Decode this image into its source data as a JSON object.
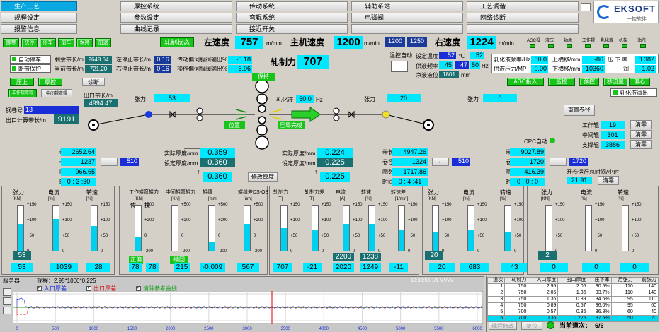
{
  "menu": [
    {
      "label": "生产工艺",
      "arrow": "⇩",
      "active": true
    },
    {
      "label": "规程设定",
      "arrow": ""
    },
    {
      "label": "报警信息",
      "arrow": ""
    },
    {
      "label": "厚控系统",
      "arrow": "⇩"
    },
    {
      "label": "参数设定",
      "arrow": ""
    },
    {
      "label": "曲线记录",
      "arrow": ""
    },
    {
      "label": "传动系统",
      "arrow": "⇩"
    },
    {
      "label": "弯辊系统",
      "arrow": "⇩"
    },
    {
      "label": "接近开关",
      "arrow": ""
    },
    {
      "label": "辅助系站",
      "arrow": "⇩"
    },
    {
      "label": "电磁阀",
      "arrow": "⇩"
    },
    {
      "label": "",
      "arrow": ""
    },
    {
      "label": "工艺调谐",
      "arrow": ""
    },
    {
      "label": "网络诊断",
      "arrow": ""
    },
    {
      "label": "",
      "arrow": ""
    }
  ],
  "brand": {
    "name": "EKSOFT",
    "sub": "一控软件"
  },
  "toolbar": {
    "buttons": [
      "御带",
      "快停",
      "停车",
      "前车",
      "保持",
      "加速"
    ],
    "state": "轧制状态"
  },
  "speed": {
    "left_label": "左速度",
    "left": "757",
    "mid_label": "主机速度",
    "mid": "1200",
    "mid_set": "1200",
    "mid_set2": "1250",
    "right_label": "右速度",
    "right": "1224",
    "unit": "m/min"
  },
  "agc": {
    "labels": [
      "AGC投",
      "液压",
      "轴承",
      "工作辊",
      "乳化液",
      "机架",
      "油汽"
    ]
  },
  "left_ctrl": {
    "auto_stop": "自动停车",
    "broken": "断带保护",
    "remain_label": "剩余带长/m",
    "remain": "2648.64",
    "first_label": "当前带长/m",
    "first": "721.20",
    "lstop_label": "左停止带长/m",
    "lstop": "0.16",
    "rstop_label": "右停止带长/m",
    "rstop": "0.16",
    "drive_label": "传动偏伺服阀输出%",
    "drive": "-5.18",
    "op_label": "操作偏伺服阀输出%",
    "op": "-6.96"
  },
  "force": {
    "label": "轧制力",
    "value": "707"
  },
  "temp": {
    "auto": "温控自动",
    "set_label": "设定温度",
    "set": "52",
    "unit": "℃",
    "set2": "52",
    "flow_label": "供液频率",
    "f1": "45",
    "f2": "47",
    "f3": "50",
    "hz": "Hz",
    "net_label": "净液液位",
    "net": "1801",
    "mm": "mm"
  },
  "emul": {
    "freq_label": "乳化液频率/Hz",
    "freq": "50.0",
    "press_label": "供液压力/MP",
    "press": "0.00",
    "up_label": "上横移/mm",
    "up": "-86",
    "down_label": "下横移/mm",
    "down": "-10360",
    "pxd_label": "压 下 率",
    "pxd": "0.382",
    "rl_label": "润",
    "rl": "1.02"
  },
  "agc_btns": [
    "AGC投入",
    "监控",
    "预控",
    "秒流量",
    "偏心"
  ],
  "overflow": "乳化液溢出",
  "mode": {
    "a": "压上",
    "b": "厚控",
    "c": "诊断",
    "d": "工作辊弯辊",
    "e": "中间辊弯辊"
  },
  "coil": {
    "steel_label": "钢卷号",
    "steel": "13",
    "out_label": "出口计算带长/m",
    "out": "9191",
    "exit_label": "出口带长/m",
    "exit": "4994.47"
  },
  "mill": {
    "tension_l_label": "张力",
    "tension_l": "53",
    "tension_r_label": "张力",
    "tension_r": "20",
    "tension_rr_label": "张力",
    "tension_rr": "0",
    "emul_label": "乳化液",
    "emul": "50.0",
    "emul_unit": "Hz",
    "hold": "保持",
    "pos": "位置",
    "press": "压靠完成",
    "reset": "重置卷径",
    "cpc": "CPC自动"
  },
  "right_coil": {
    "wr_label": "工作辊",
    "wr": "19",
    "mr_label": "中间辊",
    "mr": "301",
    "br_label": "支撑辊",
    "br": "3886",
    "clear": "清零"
  },
  "left_reel": {
    "len_label": "带长/m",
    "len": "2652.64",
    "dia_label": "卷径/mm",
    "dia": "1237",
    "dia_set": "510",
    "turns_label": "圈数",
    "turns": "966.65",
    "time_label": "时间",
    "time": "0 : 3 :30"
  },
  "thick_in": {
    "act_label": "实际厚度/mm",
    "act": "0.359",
    "set_label": "设定厚度/mm",
    "set": "0.360",
    "sel": "0.360",
    "modify": "修改厚度"
  },
  "thick_out": {
    "act_label": "实际厚度/mm",
    "act": "0.224",
    "set_label": "设定厚度/mm",
    "set": "0.225",
    "sel": "0.225"
  },
  "mid_reel": {
    "len_label": "带长/m",
    "len": "4947.26",
    "dia_label": "卷径/mm",
    "dia": "1324",
    "dia_set": "510",
    "turns_label": "圈数",
    "turns": "1717.86",
    "time_label": "时间",
    "time": "0 : 4 :41"
  },
  "right_reel": {
    "len_label": "带长/m",
    "len": "9027.89",
    "dia_label": "卷径/mm",
    "dia": "1720",
    "dia_set": "1720",
    "turns_label": "圈数",
    "turns": "416.39",
    "time_label": "时间",
    "time": "0 : 0 : 0",
    "run_label": "开卷运行总时间/小时",
    "run": "21.91",
    "clear": "清零"
  },
  "gauges": {
    "g1": {
      "t1": "张力",
      "u1": "[KN]",
      "t2": "电流",
      "u2": "[%]",
      "t3": "转速",
      "u3": "[%]",
      "v1": "53",
      "v2": "1039",
      "v3": "28",
      "s1": "53"
    },
    "g2": {
      "t1": "工作辊弯辊力",
      "u1": "[KN]",
      "t2": "中间辊弯辊力",
      "u2": "[KN]",
      "t3": "辊缝",
      "u3": "[mm]",
      "t4": "辊缝差DS-OS",
      "u4": "[um]",
      "v1": "78",
      "v2": "78",
      "v3": "215",
      "v4": "-0.009",
      "v5": "567",
      "s1": "正偏",
      "s2": "编回",
      "tw": "传",
      "ts": "操"
    },
    "g3": {
      "t1": "轧制力",
      "u1": "[T]",
      "t2": "轧制力差",
      "u2": "[T]",
      "t3": "电流",
      "u3": "[A]",
      "t4": "转速",
      "u4": "[%]",
      "t5": "转速差",
      "u5": "[1/min]",
      "v1": "707",
      "v2": "-21",
      "v3": "2020",
      "v4": "1249",
      "v5": "-11",
      "s3": "2200",
      "s4": "1238"
    },
    "g4": {
      "t1": "张力",
      "u1": "[KN]",
      "t2": "电流",
      "u2": "[%]",
      "t3": "转速",
      "u3": "[%]",
      "v1": "20",
      "v2": "683",
      "v3": "43",
      "s1": "20"
    },
    "g5": {
      "t1": "张力",
      "u1": "[KN]",
      "t2": "电流",
      "u2": "[%]",
      "t3": "转速",
      "u3": "[%]",
      "v1": "0",
      "v2": "0",
      "v3": "0",
      "s1": "2"
    }
  },
  "trend": {
    "server": "服务器",
    "spec": "规程：2.95*1000*0.225",
    "l1": "入口厚差",
    "l2": "出口厚差",
    "l3": "清除参考曲线",
    "watermark": "12:30:56 1/1  MVVV",
    "xticks": [
      "0",
      "500",
      "1000",
      "1500",
      "2000",
      "2500",
      "3000",
      "3500",
      "4000",
      "4500",
      "5000",
      "5500",
      "6000"
    ],
    "yticks": [
      "50",
      "0",
      "-50"
    ]
  },
  "table": {
    "headers": [
      "道次",
      "轧制力",
      "入口厚度",
      "出口厚度",
      "压下率",
      "后张力",
      "前张力"
    ],
    "rows": [
      [
        "1",
        "750",
        "2.95",
        "2.05",
        "30.5%",
        "110",
        "140"
      ],
      [
        "2",
        "750",
        "2.05",
        "1.36",
        "33.7%",
        "110",
        "140"
      ],
      [
        "3",
        "750",
        "1.36",
        "0.89",
        "34.6%",
        "95",
        "110"
      ],
      [
        "4",
        "750",
        "0.89",
        "0.57",
        "36.0%",
        "95",
        "60"
      ],
      [
        "5",
        "700",
        "0.57",
        "0.36",
        "36.8%",
        "60",
        "40"
      ],
      [
        "6",
        "700",
        "0.36",
        "0.225",
        "37.5%",
        "50",
        "20"
      ]
    ],
    "btn1": "规程修改",
    "btn2": "复位",
    "cur_label": "当前道次：",
    "cur": "6/6"
  }
}
